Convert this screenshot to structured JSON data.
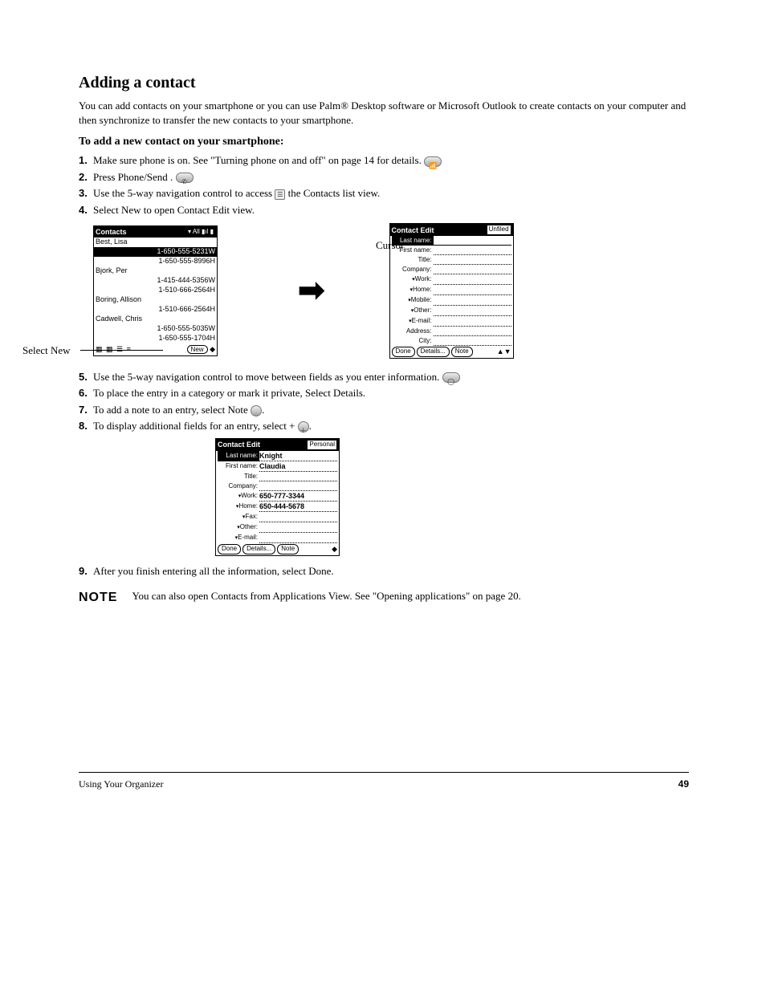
{
  "section": {
    "title": "Adding a contact",
    "intro": "You can add contacts on your smartphone or you can use Palm® Desktop software or Microsoft Outlook to create contacts on your computer and then synchronize to transfer the new contacts to your smartphone."
  },
  "subhead": "To add a new contact on your smartphone:",
  "steps1": [
    "Make sure phone is on. See \"Turning phone on and off\" on page 14 for details.",
    "Press Phone/Send .",
    "Use the 5-way navigation control to access  the Contacts list view.",
    "Select New to open Contact Edit view."
  ],
  "contacts_screen": {
    "title": "Contacts",
    "filter": "All",
    "rows": [
      {
        "name": "Best, Lisa",
        "phone": ""
      },
      {
        "name": "",
        "phone": "1-650-555-5231W",
        "sel": true
      },
      {
        "name": "",
        "phone": "1-650-555-8996H"
      },
      {
        "name": "Bjork, Per",
        "phone": ""
      },
      {
        "name": "",
        "phone": "1-415-444-5356W"
      },
      {
        "name": "",
        "phone": "1-510-666-2564H"
      },
      {
        "name": "Boring, Allison",
        "phone": ""
      },
      {
        "name": "",
        "phone": "1-510-666-2564H"
      },
      {
        "name": "Cadwell, Chris",
        "phone": ""
      },
      {
        "name": "",
        "phone": "1-650-555-5035W"
      },
      {
        "name": "",
        "phone": "1-650-555-1704H"
      }
    ],
    "new_btn": "New"
  },
  "edit_blank": {
    "title": "Contact Edit",
    "category": "Unfiled",
    "fields": [
      {
        "label": "Last name:",
        "dropdown": false,
        "sel": true,
        "val": ""
      },
      {
        "label": "First name:",
        "dropdown": false,
        "val": ""
      },
      {
        "label": "Title:",
        "dropdown": false,
        "val": ""
      },
      {
        "label": "Company:",
        "dropdown": false,
        "val": ""
      },
      {
        "label": "Work:",
        "dropdown": true,
        "val": ""
      },
      {
        "label": "Home:",
        "dropdown": true,
        "val": ""
      },
      {
        "label": "Mobile:",
        "dropdown": true,
        "val": ""
      },
      {
        "label": "Other:",
        "dropdown": true,
        "val": ""
      },
      {
        "label": "E-mail:",
        "dropdown": true,
        "val": ""
      },
      {
        "label": "Address:",
        "dropdown": false,
        "val": ""
      },
      {
        "label": "City:",
        "dropdown": false,
        "val": ""
      }
    ],
    "buttons": [
      "Done",
      "Details...",
      "Note"
    ]
  },
  "callouts": {
    "sel_new": "Select New",
    "cursor": "Cursor"
  },
  "steps2": [
    "Use the 5-way navigation control to move between fields as you enter information.",
    "To place the entry in a category or mark it private, Select Details.",
    "To add a note to an entry, select Note .",
    "To display additional fields for an entry, select + ."
  ],
  "edit_filled": {
    "title": "Contact Edit",
    "category": "Personal",
    "fields": [
      {
        "label": "Last name:",
        "dropdown": false,
        "sel": true,
        "val": "Knight"
      },
      {
        "label": "First name:",
        "dropdown": false,
        "val": "Claudia"
      },
      {
        "label": "Title:",
        "dropdown": false,
        "val": ""
      },
      {
        "label": "Company:",
        "dropdown": false,
        "val": ""
      },
      {
        "label": "Work:",
        "dropdown": true,
        "val": "650-777-3344"
      },
      {
        "label": "Home:",
        "dropdown": true,
        "val": "650-444-5678"
      },
      {
        "label": "Fax:",
        "dropdown": true,
        "val": ""
      },
      {
        "label": "Other:",
        "dropdown": true,
        "val": ""
      },
      {
        "label": "E-mail:",
        "dropdown": true,
        "val": ""
      }
    ],
    "buttons": [
      "Done",
      "Details...",
      "Note"
    ]
  },
  "step_after": "After you finish entering all the information, select Done.",
  "note": {
    "label": "NOTE",
    "text": "You can also open Contacts from Applications View. See \"Opening applications\" on page 20."
  },
  "footer": {
    "left": "Using Your Organizer",
    "right": "49"
  },
  "icons": {
    "wireless": "wl",
    "phone": "ph",
    "nav": "nv",
    "note": "nt",
    "contacts": "ct",
    "plus": "+"
  }
}
